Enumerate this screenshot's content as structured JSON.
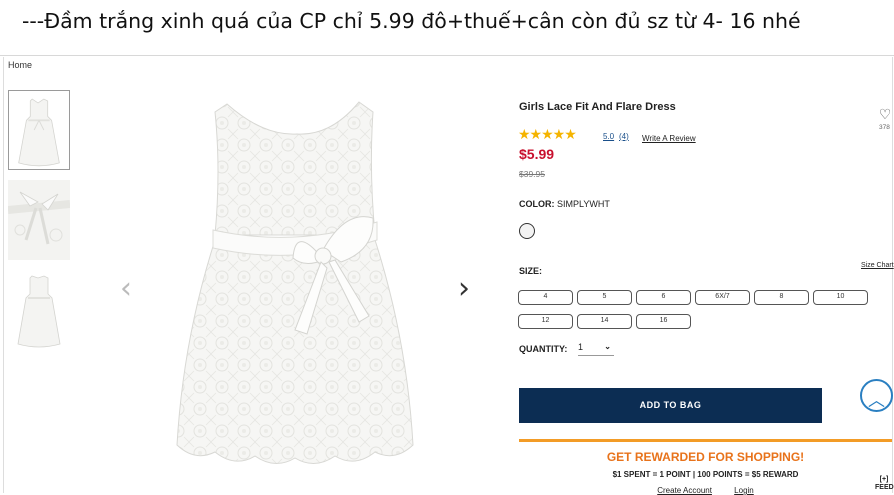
{
  "caption": "---Đầm trắng xinh quá của CP chỉ 5.99 đô+thuế+cân còn đủ sz từ 4- 16 nhé",
  "breadcrumb": "Home",
  "product": {
    "title": "Girls Lace Fit And Flare Dress",
    "rating_stars": "★★★★★",
    "rating": "5.0",
    "rating_count": "(4)",
    "review_link": "Write A Review",
    "price": "$5.99",
    "old_price": "$39.95",
    "wishlist_count": "378",
    "color_label": "COLOR:",
    "color_value": "SIMPLYWHT",
    "size_label": "SIZE:",
    "size_chart_link": "Size Chart",
    "sizes": [
      "4",
      "5",
      "6",
      "6X/7",
      "8",
      "10",
      "12",
      "14",
      "16"
    ],
    "quantity_label": "QUANTITY:",
    "quantity_value": "1",
    "add_button": "ADD TO BAG"
  },
  "rewards": {
    "title": "GET REWARDED FOR SHOPPING!",
    "subtitle": "$1 SPENT = 1 POINT | 100 POINTS = $5 REWARD",
    "create_account": "Create Account",
    "login": "Login"
  },
  "feedback_label": "[+] FEEDBACK",
  "icons": {
    "heart": "heart-icon",
    "prev": "chevron-left-icon",
    "next": "chevron-right-icon",
    "scroll_top": "chevron-up-icon",
    "quantity": "chevron-down-icon"
  },
  "colors": {
    "price": "#c8102e",
    "button": "#0c2d53",
    "stars": "#f5b400",
    "rewards": "#e8731b",
    "accent_blue": "#2a7fc1"
  }
}
